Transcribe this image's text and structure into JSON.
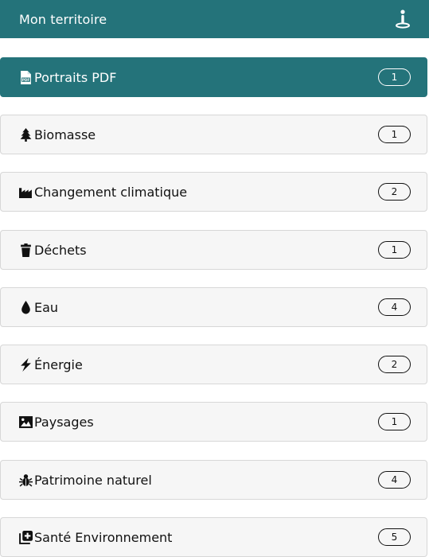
{
  "header": {
    "title": "Mon territoire",
    "icon": "location-pin-icon"
  },
  "colors": {
    "accent": "#24737a",
    "item_bg": "#f6f6f6",
    "item_border": "#d7d7d7"
  },
  "items": [
    {
      "label": "Portraits PDF",
      "count": "1",
      "icon": "pdf-icon",
      "active": true
    },
    {
      "label": "Biomasse",
      "count": "1",
      "icon": "tree-icon",
      "active": false
    },
    {
      "label": "Changement climatique",
      "count": "2",
      "icon": "industry-icon",
      "active": false
    },
    {
      "label": "Déchets",
      "count": "1",
      "icon": "trash-icon",
      "active": false
    },
    {
      "label": "Eau",
      "count": "4",
      "icon": "water-drop-icon",
      "active": false
    },
    {
      "label": "Énergie",
      "count": "2",
      "icon": "lightning-icon",
      "active": false
    },
    {
      "label": "Paysages",
      "count": "1",
      "icon": "image-icon",
      "active": false
    },
    {
      "label": "Patrimoine naturel",
      "count": "4",
      "icon": "bug-icon",
      "active": false
    },
    {
      "label": "Santé Environnement",
      "count": "5",
      "icon": "medical-plus-icon",
      "active": false
    }
  ]
}
